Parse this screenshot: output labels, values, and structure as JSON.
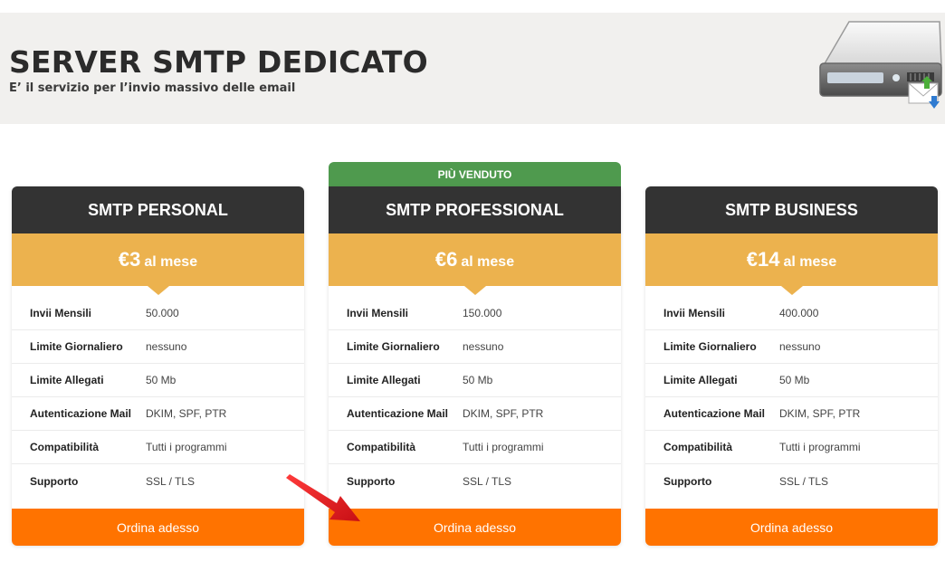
{
  "hero": {
    "title": "SERVER SMTP DEDICATO",
    "subtitle": "E’ il servizio per l’invio massivo delle email",
    "icon": "server-mail-icon"
  },
  "ribbon": {
    "label": "PIÙ VENDUTO",
    "color": "#4f9a4e"
  },
  "colors": {
    "head": "#333333",
    "price": "#ecb24e",
    "button": "#ff7300"
  },
  "plans": [
    {
      "name": "SMTP PERSONAL",
      "price": "€3",
      "period": "al mese",
      "features": [
        {
          "label": "Invii Mensili",
          "value": "50.000"
        },
        {
          "label": "Limite Giornaliero",
          "value": "nessuno"
        },
        {
          "label": "Limite Allegati",
          "value": "50 Mb"
        },
        {
          "label": "Autenticazione Mail",
          "value": "DKIM, SPF, PTR"
        },
        {
          "label": "Compatibilità",
          "value": "Tutti i programmi"
        },
        {
          "label": "Supporto",
          "value": "SSL / TLS"
        }
      ],
      "button": "Ordina adesso"
    },
    {
      "name": "SMTP PROFESSIONAL",
      "price": "€6",
      "period": "al mese",
      "features": [
        {
          "label": "Invii Mensili",
          "value": "150.000"
        },
        {
          "label": "Limite Giornaliero",
          "value": "nessuno"
        },
        {
          "label": "Limite Allegati",
          "value": "50 Mb"
        },
        {
          "label": "Autenticazione Mail",
          "value": "DKIM, SPF, PTR"
        },
        {
          "label": "Compatibilità",
          "value": "Tutti i programmi"
        },
        {
          "label": "Supporto",
          "value": "SSL / TLS"
        }
      ],
      "button": "Ordina adesso"
    },
    {
      "name": "SMTP BUSINESS",
      "price": "€14",
      "period": "al mese",
      "features": [
        {
          "label": "Invii Mensili",
          "value": "400.000"
        },
        {
          "label": "Limite Giornaliero",
          "value": "nessuno"
        },
        {
          "label": "Limite Allegati",
          "value": "50 Mb"
        },
        {
          "label": "Autenticazione Mail",
          "value": "DKIM, SPF, PTR"
        },
        {
          "label": "Compatibilità",
          "value": "Tutti i programmi"
        },
        {
          "label": "Supporto",
          "value": "SSL / TLS"
        }
      ],
      "button": "Ordina adesso"
    }
  ],
  "annotation": {
    "icon": "red-arrow-icon",
    "color": "#e3161b"
  }
}
